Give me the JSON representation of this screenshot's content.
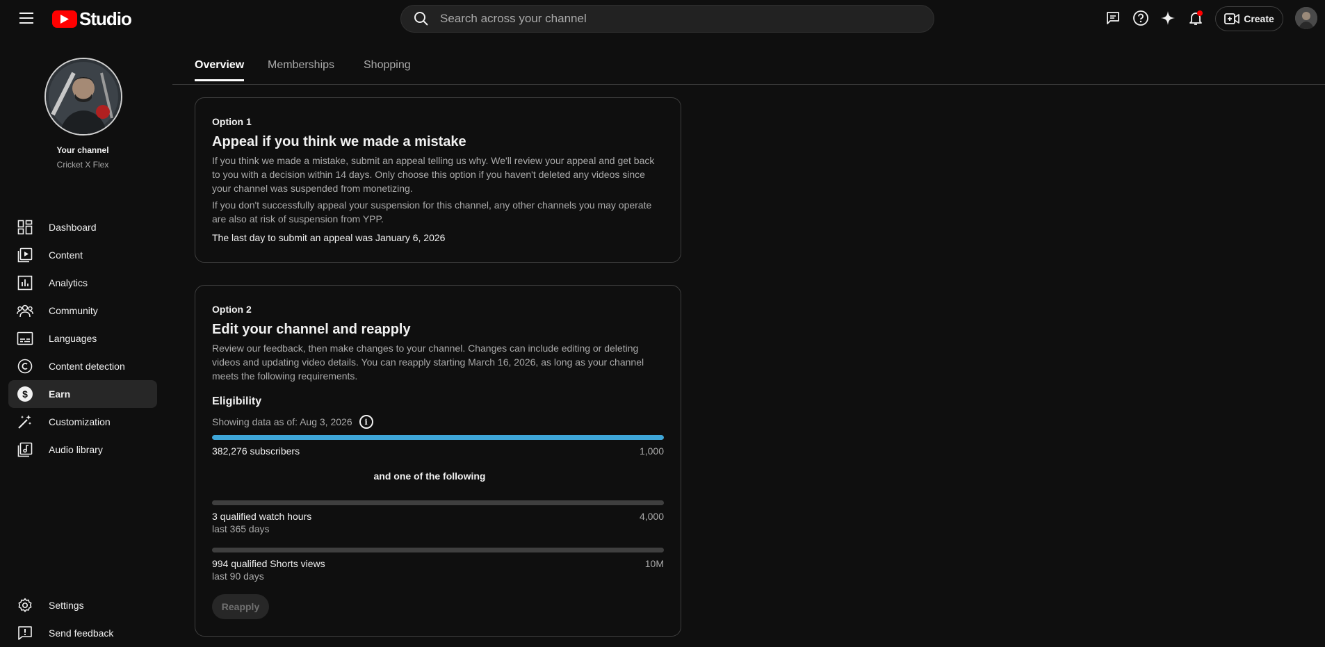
{
  "header": {
    "logo_text": "Studio",
    "search_placeholder": "Search across your channel",
    "create_label": "Create"
  },
  "channel": {
    "title": "Your channel",
    "name": "Cricket X Flex"
  },
  "sidebar": {
    "items": [
      {
        "label": "Dashboard",
        "icon": "dashboard-icon"
      },
      {
        "label": "Content",
        "icon": "content-icon"
      },
      {
        "label": "Analytics",
        "icon": "analytics-icon"
      },
      {
        "label": "Community",
        "icon": "community-icon"
      },
      {
        "label": "Languages",
        "icon": "languages-icon"
      },
      {
        "label": "Content detection",
        "icon": "copyright-icon"
      },
      {
        "label": "Earn",
        "icon": "dollar-icon",
        "active": true
      },
      {
        "label": "Customization",
        "icon": "magic-wand-icon"
      },
      {
        "label": "Audio library",
        "icon": "audio-library-icon"
      }
    ],
    "bottom": [
      {
        "label": "Settings",
        "icon": "gear-icon"
      },
      {
        "label": "Send feedback",
        "icon": "feedback-icon"
      }
    ]
  },
  "tabs": [
    {
      "label": "Overview",
      "active": true
    },
    {
      "label": "Memberships"
    },
    {
      "label": "Shopping"
    }
  ],
  "option1": {
    "label": "Option 1",
    "title": "Appeal if you think we made a mistake",
    "p1": "If you think we made a mistake, submit an appeal telling us why. We'll review your appeal and get back to you with a decision within 14 days. Only choose this option if you haven't deleted any videos since your channel was suspended from monetizing.",
    "p2": "If you don't successfully appeal your suspension for this channel, any other channels you may operate are also at risk of suspension from YPP.",
    "deadline": "The last day to submit an appeal was January 6, 2026"
  },
  "option2": {
    "label": "Option 2",
    "title": "Edit your channel and reapply",
    "p1": "Review our feedback, then make changes to your channel. Changes can include editing or deleting videos and updating video details. You can reapply starting March 16, 2026, as long as your channel meets the following requirements.",
    "eligibility_title": "Eligibility",
    "as_of": "Showing data as of: Aug 3, 2026",
    "and_one": "and one of the following",
    "reapply_label": "Reapply",
    "requirements": [
      {
        "label": "382,276 subscribers",
        "max": "1,000",
        "progress": 1.0
      },
      {
        "label": "3 qualified watch hours",
        "sub": "last 365 days",
        "max": "4,000",
        "progress": 0.0
      },
      {
        "label": "994 qualified Shorts views",
        "sub": "last 90 days",
        "max": "10M",
        "progress": 0.0
      }
    ]
  },
  "colors": {
    "accent": "#3ea6d8",
    "brand_red": "#ff0000",
    "background": "#0f0f0f"
  }
}
